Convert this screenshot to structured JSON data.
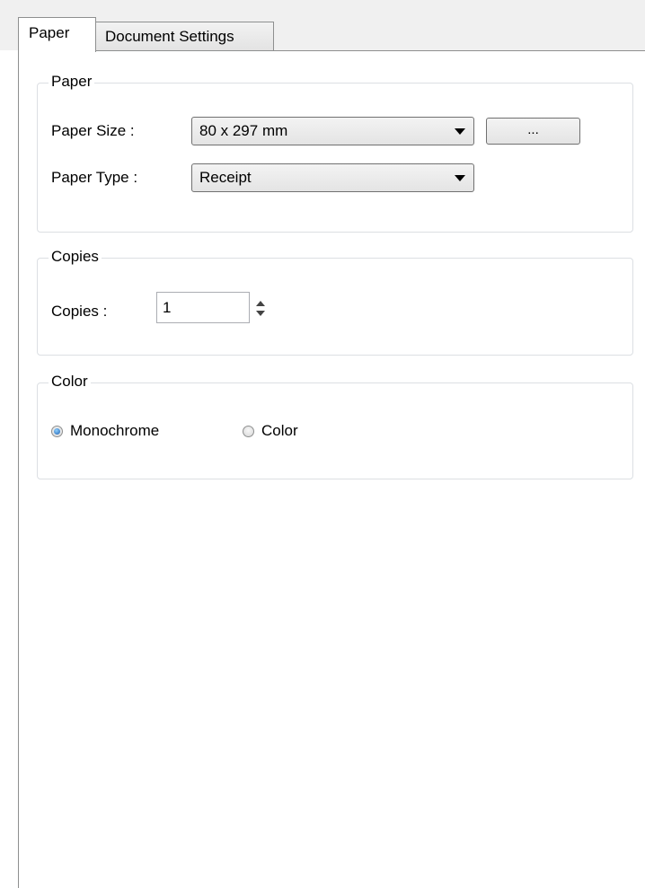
{
  "tabs": [
    {
      "label": "Paper",
      "active": true
    },
    {
      "label": "Document Settings",
      "active": false
    }
  ],
  "paper_group": {
    "title": "Paper",
    "paper_size_label": "Paper Size :",
    "paper_size_value": "80 x 297 mm",
    "browse_label": "...",
    "paper_type_label": "Paper Type :",
    "paper_type_value": "Receipt"
  },
  "copies_group": {
    "title": "Copies",
    "copies_label": "Copies :",
    "copies_value": "1"
  },
  "color_group": {
    "title": "Color",
    "options": [
      {
        "label": "Monochrome",
        "selected": true
      },
      {
        "label": "Color",
        "selected": false
      }
    ]
  },
  "colors": {
    "accent": "#1b5fb0",
    "border": "#8e8f8f",
    "group_border": "#dcdfe3"
  }
}
